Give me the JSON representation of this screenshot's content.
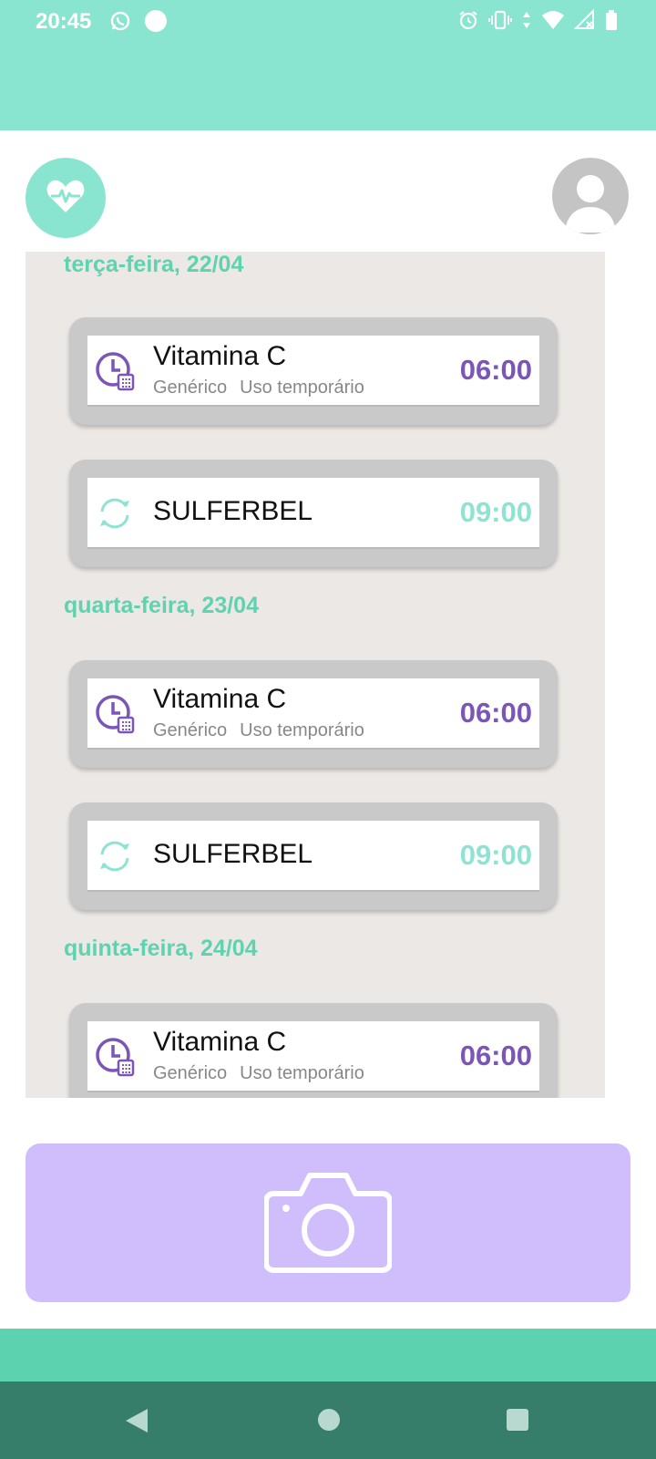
{
  "status_bar": {
    "time": "20:45",
    "left_icons": [
      "whatsapp-icon",
      "circle-notification-icon"
    ],
    "right_icons": [
      "alarm-icon",
      "vibrate-icon",
      "data-arrows-icon",
      "wifi-icon",
      "no-signal-icon",
      "battery-icon"
    ]
  },
  "header": {
    "logo_icon": "heart-pulse-icon",
    "avatar_icon": "person-avatar-icon"
  },
  "colors": {
    "teal": "#89e5d0",
    "teal_text": "#5fd2af",
    "purple": "#7b55b8",
    "purple_light": "#cfbdfc",
    "nav_dark": "#367e69"
  },
  "schedule": {
    "days": [
      {
        "label": "terça-feira, 22/04",
        "items": [
          {
            "name": "Vitamina C",
            "brand": "Genérico",
            "usage": "Uso temporário",
            "time": "06:00",
            "icon": "clock-calendar-icon"
          },
          {
            "name": "SULFERBEL",
            "time": "09:00",
            "icon": "recurring-arrows-icon"
          }
        ]
      },
      {
        "label": "quarta-feira, 23/04",
        "items": [
          {
            "name": "Vitamina C",
            "brand": "Genérico",
            "usage": "Uso temporário",
            "time": "06:00",
            "icon": "clock-calendar-icon"
          },
          {
            "name": "SULFERBEL",
            "time": "09:00",
            "icon": "recurring-arrows-icon"
          }
        ]
      },
      {
        "label": "quinta-feira, 24/04",
        "items": [
          {
            "name": "Vitamina C",
            "brand": "Genérico",
            "usage": "Uso temporário",
            "time": "06:00",
            "icon": "clock-calendar-icon"
          }
        ]
      }
    ]
  },
  "camera_button": {
    "icon": "camera-icon"
  },
  "nav_bar": {
    "icons": [
      "back-icon",
      "home-icon",
      "recents-icon"
    ]
  }
}
